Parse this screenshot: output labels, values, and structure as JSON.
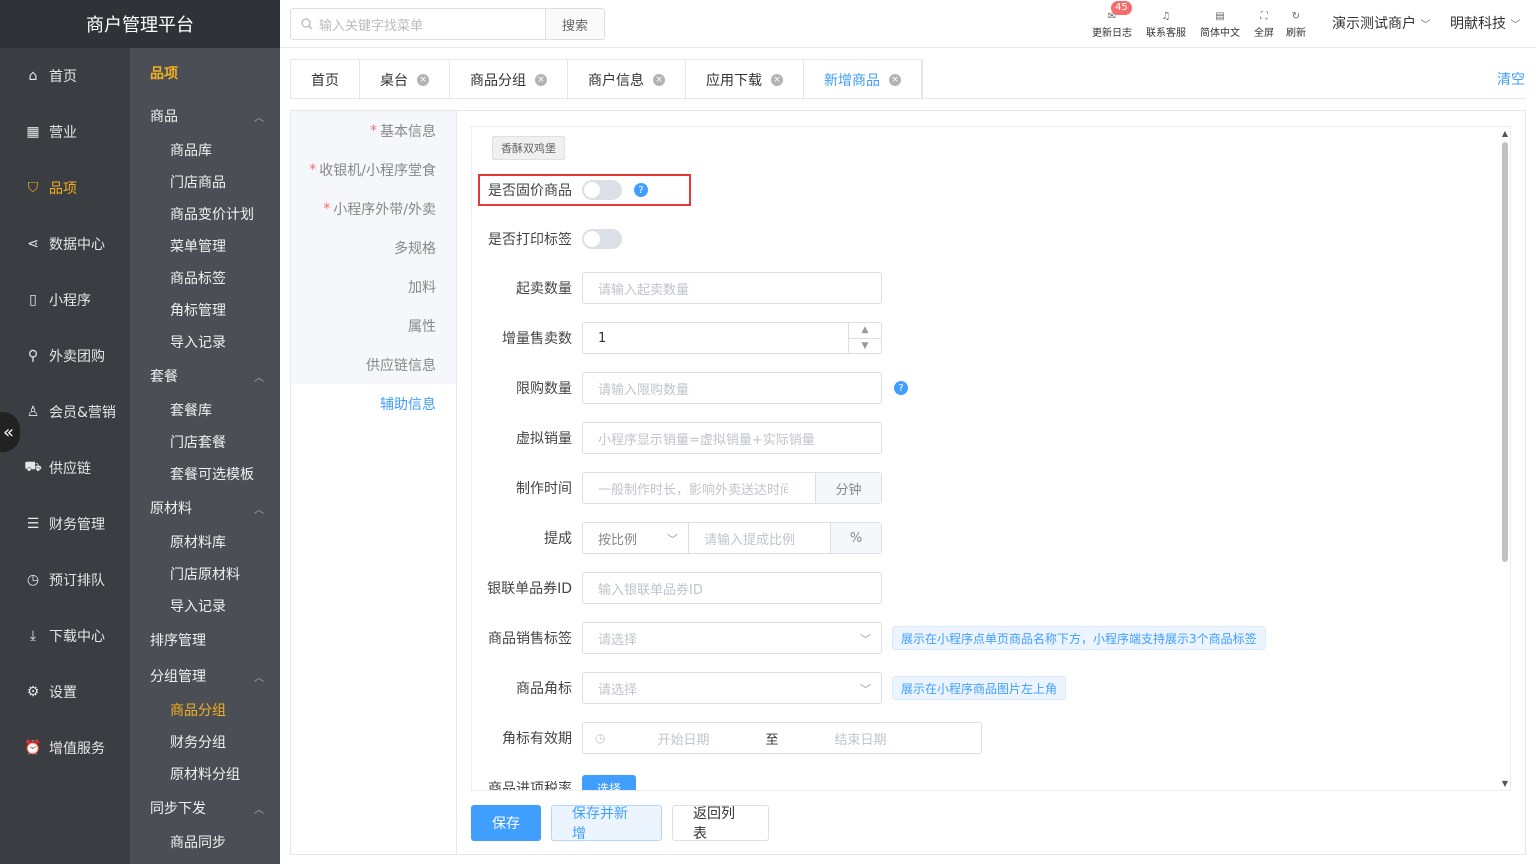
{
  "app": {
    "title": "商户管理平台"
  },
  "search": {
    "placeholder": "输入关键字找菜单",
    "button": "搜索"
  },
  "toolbar": {
    "changelog": {
      "label": "更新日志",
      "badge": "45"
    },
    "support": "联系客服",
    "language": "简体中文",
    "fullscreen": "全屏",
    "refresh": "刷新"
  },
  "account": {
    "merchant": "演示测试商户",
    "company": "明献科技"
  },
  "sidebar": {
    "items": [
      {
        "label": "首页",
        "icon": "home-icon"
      },
      {
        "label": "营业",
        "icon": "calendar-icon"
      },
      {
        "label": "品项",
        "icon": "bag-icon",
        "active": true
      },
      {
        "label": "数据中心",
        "icon": "share-icon"
      },
      {
        "label": "小程序",
        "icon": "phone-icon"
      },
      {
        "label": "外卖团购",
        "icon": "bike-icon"
      },
      {
        "label": "会员&营销",
        "icon": "user-icon"
      },
      {
        "label": "供应链",
        "icon": "truck-icon"
      },
      {
        "label": "财务管理",
        "icon": "database-icon"
      },
      {
        "label": "预订排队",
        "icon": "clock-icon"
      },
      {
        "label": "下载中心",
        "icon": "download-icon"
      },
      {
        "label": "设置",
        "icon": "gear-icon"
      },
      {
        "label": "增值服务",
        "icon": "alarm-icon"
      }
    ]
  },
  "submenu": {
    "title": "品项",
    "groups": [
      {
        "label": "商品",
        "items": [
          "商品库",
          "门店商品",
          "商品变价计划",
          "菜单管理",
          "商品标签",
          "角标管理",
          "导入记录"
        ]
      },
      {
        "label": "套餐",
        "items": [
          "套餐库",
          "门店套餐",
          "套餐可选模板"
        ]
      },
      {
        "label": "原材料",
        "items": [
          "原材料库",
          "门店原材料",
          "导入记录"
        ]
      },
      {
        "label": "排序管理",
        "items": []
      },
      {
        "label": "分组管理",
        "items": [
          "商品分组",
          "财务分组",
          "原材料分组"
        ]
      },
      {
        "label": "同步下发",
        "items": [
          "商品同步"
        ]
      }
    ]
  },
  "tabs": [
    {
      "label": "首页",
      "closable": false
    },
    {
      "label": "桌台",
      "closable": true
    },
    {
      "label": "商品分组",
      "closable": true
    },
    {
      "label": "商户信息",
      "closable": true
    },
    {
      "label": "应用下载",
      "closable": true
    },
    {
      "label": "新增商品",
      "closable": true,
      "active": true
    }
  ],
  "clear_all": "清空",
  "anchors": [
    {
      "label": "基本信息",
      "required": true
    },
    {
      "label": "收银机/小程序堂食",
      "required": true
    },
    {
      "label": "小程序外带/外卖",
      "required": true
    },
    {
      "label": "多规格",
      "required": false
    },
    {
      "label": "加料",
      "required": false
    },
    {
      "label": "属性",
      "required": false
    },
    {
      "label": "供应链信息",
      "required": false
    },
    {
      "label": "辅助信息",
      "required": false,
      "active": true
    }
  ],
  "form": {
    "product_tag": "香酥双鸡堡",
    "fixed_price": {
      "label": "是否固价商品",
      "on": false
    },
    "print_label": {
      "label": "是否打印标签",
      "on": false
    },
    "min_qty": {
      "label": "起卖数量",
      "placeholder": "请输入起卖数量"
    },
    "increment": {
      "label": "增量售卖数",
      "value": "1"
    },
    "limit_qty": {
      "label": "限购数量",
      "placeholder": "请输入限购数量"
    },
    "virtual_sales": {
      "label": "虚拟销量",
      "placeholder": "小程序显示销量=虚拟销量+实际销量"
    },
    "make_time": {
      "label": "制作时间",
      "placeholder": "一般制作时长，影响外卖送达时间",
      "unit": "分钟"
    },
    "commission": {
      "label": "提成",
      "mode": "按比例",
      "placeholder": "请输入提成比例",
      "unit": "%"
    },
    "unionpay_id": {
      "label": "银联单品券ID",
      "placeholder": "输入银联单品券ID"
    },
    "sales_tag": {
      "label": "商品销售标签",
      "placeholder": "请选择",
      "tip": "展示在小程序点单页商品名称下方，小程序端支持展示3个商品标签"
    },
    "corner_tag": {
      "label": "商品角标",
      "placeholder": "请选择",
      "tip": "展示在小程序商品图片左上角"
    },
    "corner_validity": {
      "label": "角标有效期",
      "start": "开始日期",
      "sep": "至",
      "end": "结束日期"
    },
    "tax_rate": {
      "label": "商品进项税率",
      "button": "选择"
    }
  },
  "footer": {
    "save": "保存",
    "save_new": "保存并新增",
    "back": "返回列表"
  },
  "colors": {
    "accent": "#409eff",
    "active_menu": "#f2b021",
    "sidebar_bg": "#3a3d42",
    "highlight": "#e53935"
  }
}
